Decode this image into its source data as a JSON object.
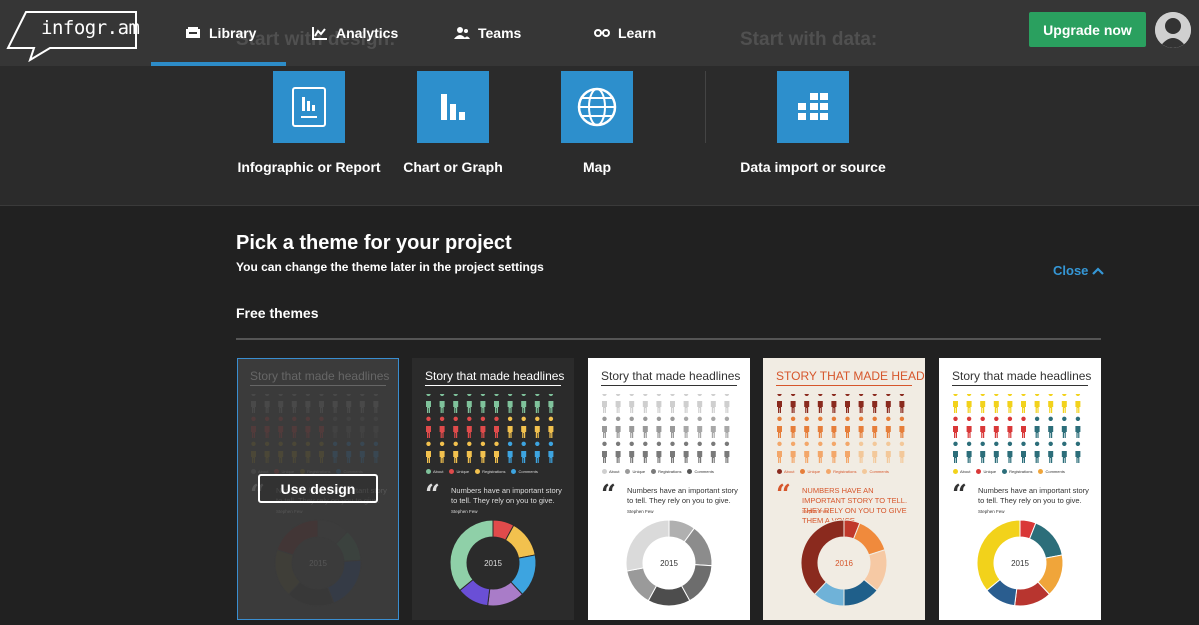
{
  "header": {
    "logo_text": "infogr.am",
    "nav": [
      {
        "label": "Library",
        "icon": "library-icon",
        "active": true
      },
      {
        "label": "Analytics",
        "icon": "analytics-icon",
        "active": false
      },
      {
        "label": "Teams",
        "icon": "teams-icon",
        "active": false
      },
      {
        "label": "Learn",
        "icon": "learn-icon",
        "active": false
      }
    ],
    "upgrade_label": "Upgrade now",
    "ghost_design": "Start with design:",
    "ghost_data": "Start with data:"
  },
  "start": {
    "tiles": [
      {
        "label": "Infographic or Report",
        "icon": "report-icon"
      },
      {
        "label": "Chart or Graph",
        "icon": "bar-chart-icon"
      },
      {
        "label": "Map",
        "icon": "globe-icon"
      },
      {
        "label": "Data import or source",
        "icon": "grid-icon"
      }
    ]
  },
  "themes_section": {
    "title": "Pick a theme for your project",
    "subtitle": "You can change the theme later in the project settings",
    "close_label": "Close",
    "free_title": "Free themes",
    "use_design_label": "Use design"
  },
  "cards": [
    {
      "title": "Story that made headlines",
      "bg": "#3a3a3a",
      "title_color": "#9a9a9a",
      "rows": [
        "#5a5a5a",
        "#6b3b3b",
        "#5d5531"
      ],
      "row_split": [
        "#5a5a5a",
        "#4b4b4b",
        "#35556d"
      ],
      "legend": [
        "About",
        "Unique",
        "Registrations",
        "Comments"
      ],
      "legend_colors": [
        "#555",
        "#6b3b3b",
        "#5d5531",
        "#35556d"
      ],
      "quote": "Numbers have an important story to tell. They rely on you to give.",
      "author": "Stephen Few",
      "text_color": "#777",
      "year": "2015",
      "donut": [
        0.12,
        0.12,
        0.2,
        0.18,
        0.18,
        0.2
      ],
      "donut_colors": [
        "#3c3c3c",
        "#3a4a42",
        "#2e3a52",
        "#333",
        "#444133",
        "#4a2f2f"
      ],
      "hole": "#3a3a3a",
      "selected": true
    },
    {
      "title": "Story that made headlines",
      "bg": "#2b2b2b",
      "title_color": "#ffffff",
      "rows": [
        "#7fc29b",
        "#e04b4b",
        "#f2c14e"
      ],
      "row_split": [
        "#7fc29b",
        "#f2c14e",
        "#3da4e0"
      ],
      "legend": [
        "About",
        "Unique",
        "Registrations",
        "Comments"
      ],
      "legend_colors": [
        "#7fc29b",
        "#e04b4b",
        "#f2c14e",
        "#3da4e0"
      ],
      "quote": "Numbers have an important story to tell. They rely on you to give.",
      "author": "Stephen Few",
      "text_color": "#dddddd",
      "year": "2015",
      "donut": [
        0.08,
        0.14,
        0.16,
        0.14,
        0.12,
        0.36
      ],
      "donut_colors": [
        "#e04b4b",
        "#f2c14e",
        "#3da4e0",
        "#a97cc8",
        "#6a4fd6",
        "#8fd0a8"
      ],
      "hole": "#2b2b2b",
      "selected": false
    },
    {
      "title": "Story that made headlines",
      "bg": "#ffffff",
      "title_color": "#333333",
      "rows": [
        "#cfcfcf",
        "#9a9a9a",
        "#7a7a7a"
      ],
      "row_split": [
        "#cfcfcf",
        "#a8a8a8",
        "#7a7a7a"
      ],
      "legend": [
        "About",
        "Unique",
        "Registrations",
        "Comments"
      ],
      "legend_colors": [
        "#cfcfcf",
        "#9a9a9a",
        "#7a7a7a",
        "#555555"
      ],
      "quote": "Numbers have an important story to tell. They rely on you to give.",
      "author": "Stephen Few",
      "text_color": "#333333",
      "year": "2015",
      "donut": [
        0.1,
        0.16,
        0.16,
        0.16,
        0.14,
        0.28
      ],
      "donut_colors": [
        "#b0b0b0",
        "#8c8c8c",
        "#6d6d6d",
        "#4d4d4d",
        "#9a9a9a",
        "#dadada"
      ],
      "hole": "#ffffff",
      "selected": false
    },
    {
      "title": "STORY THAT MADE HEADLINES",
      "bg": "#f1ece3",
      "title_color": "#d6562b",
      "rows": [
        "#8a2a1e",
        "#e67e3a",
        "#f3a76a"
      ],
      "row_split": [
        "#8a2a1e",
        "#e67e3a",
        "#f3c89a"
      ],
      "legend": [
        "About",
        "Unique",
        "Registrations",
        "Comments"
      ],
      "legend_colors": [
        "#8a2a1e",
        "#e67e3a",
        "#f3a76a",
        "#f3c89a"
      ],
      "quote": "NUMBERS HAVE AN IMPORTANT STORY TO TELL. THEY RELY ON YOU TO GIVE THEM A VOICE.",
      "author": "Stephen Few",
      "text_color": "#d6562b",
      "year": "2016",
      "donut": [
        0.06,
        0.14,
        0.16,
        0.14,
        0.12,
        0.38
      ],
      "donut_colors": [
        "#c0392b",
        "#f08a3c",
        "#f6c9a4",
        "#1f5f8a",
        "#6fb2d8",
        "#8a2a1e"
      ],
      "hole": "#f1ece3",
      "selected": false
    },
    {
      "title": "Story that made headlines",
      "bg": "#ffffff",
      "title_color": "#333333",
      "rows": [
        "#f2d21b",
        "#d93838",
        "#2c6e7a"
      ],
      "row_split": [
        "#f2d21b",
        "#2c6e7a",
        "#2c6e7a"
      ],
      "legend": [
        "About",
        "Unique",
        "Registrations",
        "Comments"
      ],
      "legend_colors": [
        "#f2d21b",
        "#d93838",
        "#2c6e7a",
        "#f0a53a"
      ],
      "quote": "Numbers have an important story to tell. They rely on you to give.",
      "author": "Stephen Few",
      "text_color": "#333333",
      "year": "2015",
      "donut": [
        0.06,
        0.16,
        0.16,
        0.14,
        0.12,
        0.36
      ],
      "donut_colors": [
        "#d93838",
        "#2c6e7a",
        "#f0a53a",
        "#b8352f",
        "#2a5d8f",
        "#f2d21b"
      ],
      "hole": "#ffffff",
      "selected": false
    }
  ]
}
